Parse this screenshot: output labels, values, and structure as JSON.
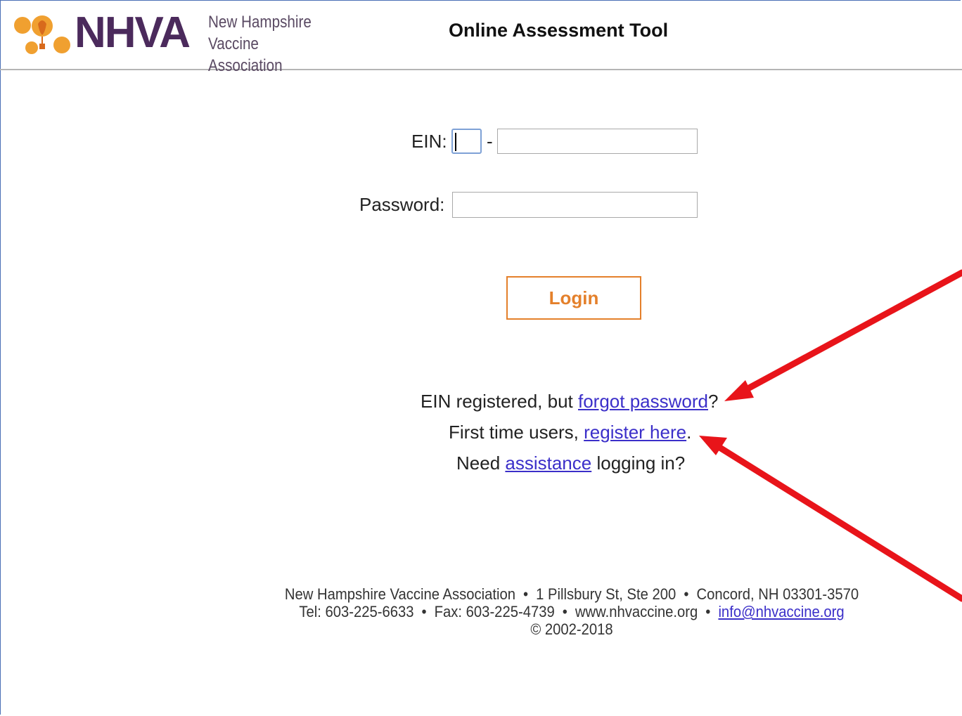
{
  "header": {
    "logo_mark": "NHVA",
    "logo_line1": "New Hampshire",
    "logo_line2": "Vaccine Association",
    "title": "Online Assessment Tool"
  },
  "login_form": {
    "ein_label": "EIN:",
    "ein_separator": "-",
    "ein_prefix_value": "",
    "ein_suffix_value": "",
    "password_label": "Password:",
    "password_value": "",
    "login_button": "Login"
  },
  "help": {
    "line1_prefix": "EIN registered, but ",
    "line1_link": "forgot password",
    "line1_suffix": "?",
    "line2_prefix": "First time users, ",
    "line2_link": "register here",
    "line2_suffix": ".",
    "line3_prefix": "Need ",
    "line3_link": "assistance",
    "line3_suffix": " logging in?"
  },
  "footer": {
    "org_name": "New Hampshire Vaccine Association",
    "address": "1 Pillsbury St, Ste 200",
    "city": "Concord, NH 03301-3570",
    "separator": "•",
    "tel": "Tel: 603-225-6633",
    "fax": "Fax: 603-225-4739",
    "website": "www.nhvaccine.org",
    "email": "info@nhvaccine.org",
    "copyright": "© 2002-2018"
  },
  "colors": {
    "brand_purple": "#4b2a5c",
    "brand_orange": "#f0a030",
    "login_orange": "#e4802b",
    "link_blue": "#3b2fc9",
    "annotation_red": "#e8141a"
  },
  "annotations": {
    "arrow1_target": "forgot-password-link",
    "arrow2_target": "register-here-link"
  }
}
